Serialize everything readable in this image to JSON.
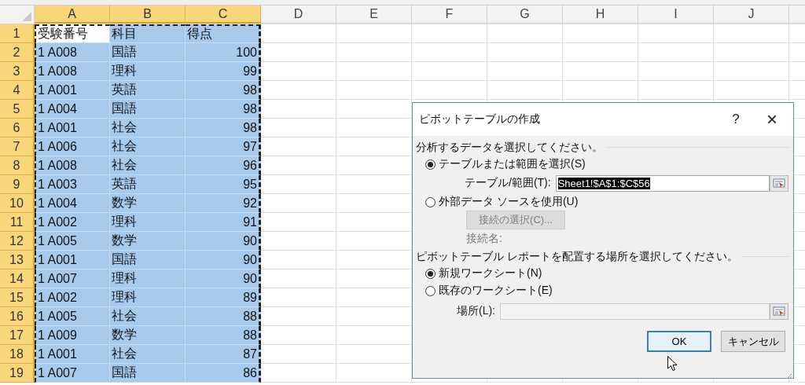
{
  "sheet": {
    "columns": [
      {
        "label": "A",
        "selected": true
      },
      {
        "label": "B",
        "selected": true
      },
      {
        "label": "C",
        "selected": true
      },
      {
        "label": "D",
        "selected": false
      },
      {
        "label": "E",
        "selected": false
      },
      {
        "label": "F",
        "selected": false
      },
      {
        "label": "G",
        "selected": false
      },
      {
        "label": "H",
        "selected": false
      },
      {
        "label": "I",
        "selected": false
      },
      {
        "label": "J",
        "selected": false
      }
    ],
    "rows": [
      {
        "number": "1",
        "selected": true,
        "cells": [
          {
            "value": "受験番号",
            "selected": true,
            "active": true,
            "kind": "text"
          },
          {
            "value": "科目",
            "selected": true,
            "active": false,
            "kind": "text"
          },
          {
            "value": "得点",
            "selected": true,
            "active": false,
            "kind": "text"
          }
        ]
      },
      {
        "number": "2",
        "selected": true,
        "cells": [
          {
            "value": "1 A008",
            "selected": true,
            "active": false,
            "kind": "text"
          },
          {
            "value": "国語",
            "selected": true,
            "active": false,
            "kind": "text"
          },
          {
            "value": "100",
            "selected": true,
            "active": false,
            "kind": "number"
          }
        ]
      },
      {
        "number": "3",
        "selected": true,
        "cells": [
          {
            "value": "1 A008",
            "selected": true,
            "active": false,
            "kind": "text"
          },
          {
            "value": "理科",
            "selected": true,
            "active": false,
            "kind": "text"
          },
          {
            "value": "99",
            "selected": true,
            "active": false,
            "kind": "number"
          }
        ]
      },
      {
        "number": "4",
        "selected": true,
        "cells": [
          {
            "value": "1 A001",
            "selected": true,
            "active": false,
            "kind": "text"
          },
          {
            "value": "英語",
            "selected": true,
            "active": false,
            "kind": "text"
          },
          {
            "value": "98",
            "selected": true,
            "active": false,
            "kind": "number"
          }
        ]
      },
      {
        "number": "5",
        "selected": true,
        "cells": [
          {
            "value": "1 A004",
            "selected": true,
            "active": false,
            "kind": "text"
          },
          {
            "value": "国語",
            "selected": true,
            "active": false,
            "kind": "text"
          },
          {
            "value": "98",
            "selected": true,
            "active": false,
            "kind": "number"
          }
        ]
      },
      {
        "number": "6",
        "selected": true,
        "cells": [
          {
            "value": "1 A001",
            "selected": true,
            "active": false,
            "kind": "text"
          },
          {
            "value": "社会",
            "selected": true,
            "active": false,
            "kind": "text"
          },
          {
            "value": "98",
            "selected": true,
            "active": false,
            "kind": "number"
          }
        ]
      },
      {
        "number": "7",
        "selected": true,
        "cells": [
          {
            "value": "1 A006",
            "selected": true,
            "active": false,
            "kind": "text"
          },
          {
            "value": "社会",
            "selected": true,
            "active": false,
            "kind": "text"
          },
          {
            "value": "97",
            "selected": true,
            "active": false,
            "kind": "number"
          }
        ]
      },
      {
        "number": "8",
        "selected": true,
        "cells": [
          {
            "value": "1 A008",
            "selected": true,
            "active": false,
            "kind": "text"
          },
          {
            "value": "社会",
            "selected": true,
            "active": false,
            "kind": "text"
          },
          {
            "value": "96",
            "selected": true,
            "active": false,
            "kind": "number"
          }
        ]
      },
      {
        "number": "9",
        "selected": true,
        "cells": [
          {
            "value": "1 A003",
            "selected": true,
            "active": false,
            "kind": "text"
          },
          {
            "value": "英語",
            "selected": true,
            "active": false,
            "kind": "text"
          },
          {
            "value": "95",
            "selected": true,
            "active": false,
            "kind": "number"
          }
        ]
      },
      {
        "number": "10",
        "selected": true,
        "cells": [
          {
            "value": "1 A004",
            "selected": true,
            "active": false,
            "kind": "text"
          },
          {
            "value": "数学",
            "selected": true,
            "active": false,
            "kind": "text"
          },
          {
            "value": "92",
            "selected": true,
            "active": false,
            "kind": "number"
          }
        ]
      },
      {
        "number": "11",
        "selected": true,
        "cells": [
          {
            "value": "1 A002",
            "selected": true,
            "active": false,
            "kind": "text"
          },
          {
            "value": "理科",
            "selected": true,
            "active": false,
            "kind": "text"
          },
          {
            "value": "91",
            "selected": true,
            "active": false,
            "kind": "number"
          }
        ]
      },
      {
        "number": "12",
        "selected": true,
        "cells": [
          {
            "value": "1 A005",
            "selected": true,
            "active": false,
            "kind": "text"
          },
          {
            "value": "数学",
            "selected": true,
            "active": false,
            "kind": "text"
          },
          {
            "value": "90",
            "selected": true,
            "active": false,
            "kind": "number"
          }
        ]
      },
      {
        "number": "13",
        "selected": true,
        "cells": [
          {
            "value": "1 A001",
            "selected": true,
            "active": false,
            "kind": "text"
          },
          {
            "value": "国語",
            "selected": true,
            "active": false,
            "kind": "text"
          },
          {
            "value": "90",
            "selected": true,
            "active": false,
            "kind": "number"
          }
        ]
      },
      {
        "number": "14",
        "selected": true,
        "cells": [
          {
            "value": "1 A007",
            "selected": true,
            "active": false,
            "kind": "text"
          },
          {
            "value": "理科",
            "selected": true,
            "active": false,
            "kind": "text"
          },
          {
            "value": "90",
            "selected": true,
            "active": false,
            "kind": "number"
          }
        ]
      },
      {
        "number": "15",
        "selected": true,
        "cells": [
          {
            "value": "1 A002",
            "selected": true,
            "active": false,
            "kind": "text"
          },
          {
            "value": "理科",
            "selected": true,
            "active": false,
            "kind": "text"
          },
          {
            "value": "89",
            "selected": true,
            "active": false,
            "kind": "number"
          }
        ]
      },
      {
        "number": "16",
        "selected": true,
        "cells": [
          {
            "value": "1 A005",
            "selected": true,
            "active": false,
            "kind": "text"
          },
          {
            "value": "社会",
            "selected": true,
            "active": false,
            "kind": "text"
          },
          {
            "value": "88",
            "selected": true,
            "active": false,
            "kind": "number"
          }
        ]
      },
      {
        "number": "17",
        "selected": true,
        "cells": [
          {
            "value": "1 A009",
            "selected": true,
            "active": false,
            "kind": "text"
          },
          {
            "value": "数学",
            "selected": true,
            "active": false,
            "kind": "text"
          },
          {
            "value": "88",
            "selected": true,
            "active": false,
            "kind": "number"
          }
        ]
      },
      {
        "number": "18",
        "selected": true,
        "cells": [
          {
            "value": "1 A001",
            "selected": true,
            "active": false,
            "kind": "text"
          },
          {
            "value": "社会",
            "selected": true,
            "active": false,
            "kind": "text"
          },
          {
            "value": "87",
            "selected": true,
            "active": false,
            "kind": "number"
          }
        ]
      },
      {
        "number": "19",
        "selected": true,
        "cells": [
          {
            "value": "1 A007",
            "selected": true,
            "active": false,
            "kind": "text"
          },
          {
            "value": "国語",
            "selected": true,
            "active": false,
            "kind": "text"
          },
          {
            "value": "86",
            "selected": true,
            "active": false,
            "kind": "number"
          }
        ]
      }
    ]
  },
  "dialog": {
    "title": "ピボットテーブルの作成",
    "help": "?",
    "close": "×",
    "source_heading": "分析するデータを選択してください。",
    "source_options": [
      {
        "label": "テーブルまたは範囲を選択(S)",
        "selected": true
      },
      {
        "label": "外部データ ソースを使用(U)",
        "selected": false
      }
    ],
    "range_field": {
      "label": "テーブル/範囲(T):",
      "value": "Sheet1!$A$1:$C$56",
      "value_selected": true,
      "disabled": false
    },
    "connection_button": {
      "label": "接続の選択(C)...",
      "disabled": true
    },
    "connection_name": {
      "label": "接続名:",
      "disabled": true
    },
    "placement_heading": "ピボットテーブル レポートを配置する場所を選択してください。",
    "placement_options": [
      {
        "label": "新規ワークシート(N)",
        "selected": true
      },
      {
        "label": "既存のワークシート(E)",
        "selected": false
      }
    ],
    "location_field": {
      "label": "場所(L):",
      "disabled": true
    },
    "buttons": [
      {
        "label": "OK",
        "default": true
      },
      {
        "label": "キャンセル",
        "default": false
      }
    ]
  }
}
